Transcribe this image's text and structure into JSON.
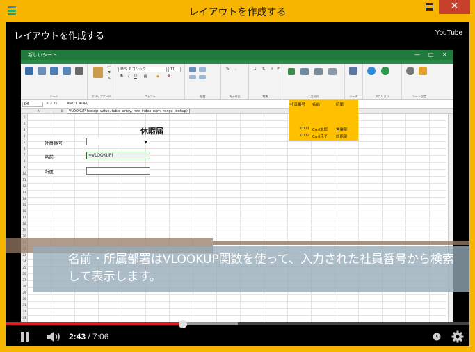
{
  "window": {
    "title": "レイアウトを作成する"
  },
  "video": {
    "title": "レイアウトを作成する",
    "brand": "YouTube",
    "caption": "名前・所属部署はVLOOKUP関数を使って、入力された社員番号から検索して表示します。",
    "time": {
      "current": "2:43",
      "separator": " / ",
      "duration": "7:06"
    },
    "progress": 0.383,
    "buffered": 0.5
  },
  "spreadsheet": {
    "app_title": "新しいシート",
    "ribbon_groups": [
      "シート",
      "クリップボード",
      "フォント",
      "配置",
      "表示形式",
      "編集",
      "入力形式",
      "データ",
      "アクション",
      "シート設定"
    ],
    "font_name": "ＭＳ Ｐゴシック",
    "font_size": "11",
    "cell_ref": "D6",
    "formula": "=VLOOKUP(",
    "tooltip": "VLOOKUP(lookup_value, table_array, row_index_num, range_lookup)",
    "form": {
      "title": "休暇届",
      "employee_no_label": "社員番号",
      "name_label": "名前",
      "dept_label": "所属",
      "name_value": "=VLOOKUP("
    },
    "lookup_table": {
      "headers": [
        "社員番号",
        "名前",
        "所属"
      ],
      "rows": [
        [
          "1001",
          "Curl太郎",
          "営業部"
        ],
        [
          "1002",
          "Curl花子",
          "総務部"
        ]
      ]
    },
    "row_numbers": [
      "1",
      "2",
      "3",
      "4",
      "5",
      "6",
      "7",
      "8",
      "9",
      "10",
      "11",
      "12",
      "13",
      "14",
      "15",
      "16",
      "17",
      "18",
      "19",
      "20",
      "21",
      "22",
      "23",
      "24",
      "25",
      "26",
      "27",
      "28",
      "29",
      "30",
      "31",
      "32",
      "33"
    ],
    "col_headers": [
      "A",
      "B"
    ]
  },
  "colors": {
    "window_frame": "#f7b500",
    "app_accent": "#1f7a3c",
    "progress_played": "#d4201c",
    "lookup_fill": "#ffc000"
  }
}
